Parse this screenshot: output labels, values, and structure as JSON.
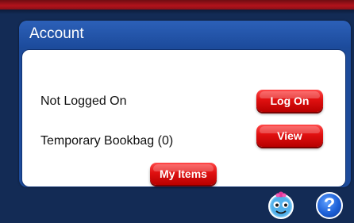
{
  "panel": {
    "title": "Account"
  },
  "rows": [
    {
      "label": "Not Logged On",
      "button": "Log On"
    },
    {
      "label": "Temporary Bookbag (0)",
      "button": "View"
    }
  ],
  "my_items_button": "My Items",
  "footer": {
    "mascot_icon": "mascot-face-icon",
    "help_icon": "help-question-icon",
    "help_glyph": "?"
  },
  "colors": {
    "background": "#132b55",
    "top_bar": "#b3131c",
    "panel_header": "#1d4b9a",
    "button_red": "#e01010"
  }
}
